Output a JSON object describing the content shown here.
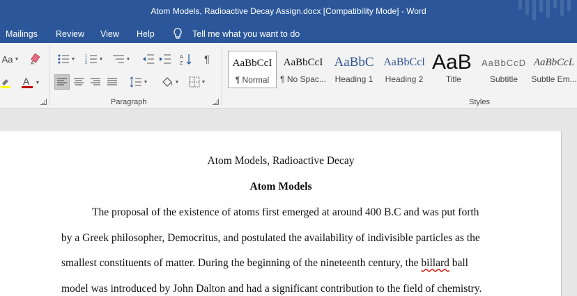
{
  "window": {
    "title": "Atom Models, Radioactive Decay Assign.docx [Compatibility Mode]  -  Word"
  },
  "menu": {
    "items": [
      "Mailings",
      "Review",
      "View",
      "Help"
    ],
    "tell_me": "Tell me what you want to do"
  },
  "ribbon": {
    "font_partial": "Aa",
    "groups": {
      "paragraph": "Paragraph",
      "styles": "Styles"
    },
    "styles": [
      {
        "sample": "AaBbCcI",
        "name": "¶ Normal"
      },
      {
        "sample": "AaBbCcI",
        "name": "¶ No Spac..."
      },
      {
        "sample": "AaBbC",
        "name": "Heading 1"
      },
      {
        "sample": "AaBbCcl",
        "name": "Heading 2"
      },
      {
        "sample": "AaB",
        "name": "Title"
      },
      {
        "sample": "AaBbCcD",
        "name": "Subtitle"
      },
      {
        "sample": "AaBbCcL",
        "name": "Subtle Em..."
      }
    ],
    "font_color": "#c00000",
    "highlight_color": "#ffff00"
  },
  "document": {
    "title_line": "Atom Models, Radioactive Decay",
    "heading": "Atom Models",
    "lines": [
      "The proposal of the existence of atoms first emerged at around 400 B.C and was put forth",
      "by a Greek philosopher, Democritus, and postulated the availability of indivisible particles as the",
      "model was introduced by John Dalton and had a significant contribution to the field of chemistry."
    ],
    "line4_before": "smallest constituents of matter. During the beginning of the nineteenth century, the ",
    "line4_misspelled": "billard",
    "line4_after": " ball"
  }
}
